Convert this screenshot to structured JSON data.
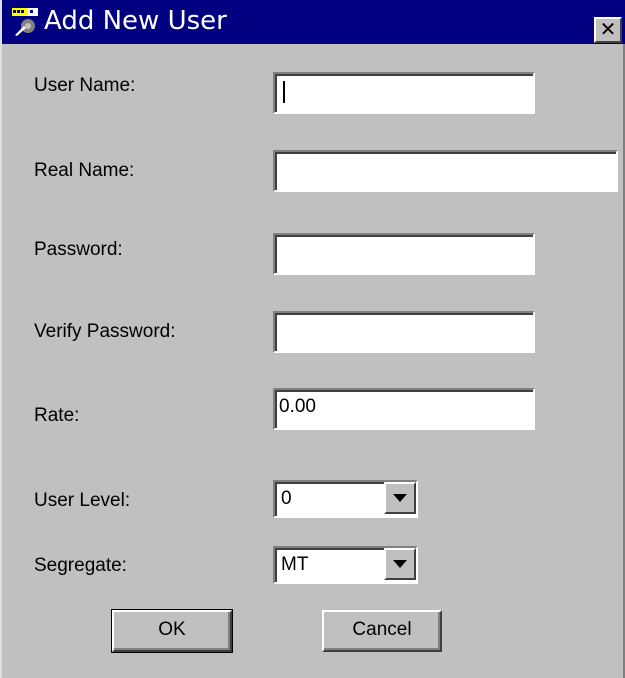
{
  "window": {
    "title": "Add New User",
    "close_glyph": "✕",
    "app_icon": "user-tool-icon"
  },
  "form": {
    "user_name": {
      "label": "User Name:",
      "value": ""
    },
    "real_name": {
      "label": "Real Name:",
      "value": ""
    },
    "password": {
      "label": "Password:",
      "value": ""
    },
    "verify_password": {
      "label": "Verify Password:",
      "value": ""
    },
    "rate": {
      "label": "Rate:",
      "value": "0.00"
    },
    "user_level": {
      "label": "User Level:",
      "value": "0"
    },
    "segregate": {
      "label": "Segregate:",
      "value": "MT"
    }
  },
  "buttons": {
    "ok_label": "OK",
    "cancel_label": "Cancel"
  },
  "colors": {
    "titlebar": "#000080",
    "face": "#c0c0c0"
  }
}
